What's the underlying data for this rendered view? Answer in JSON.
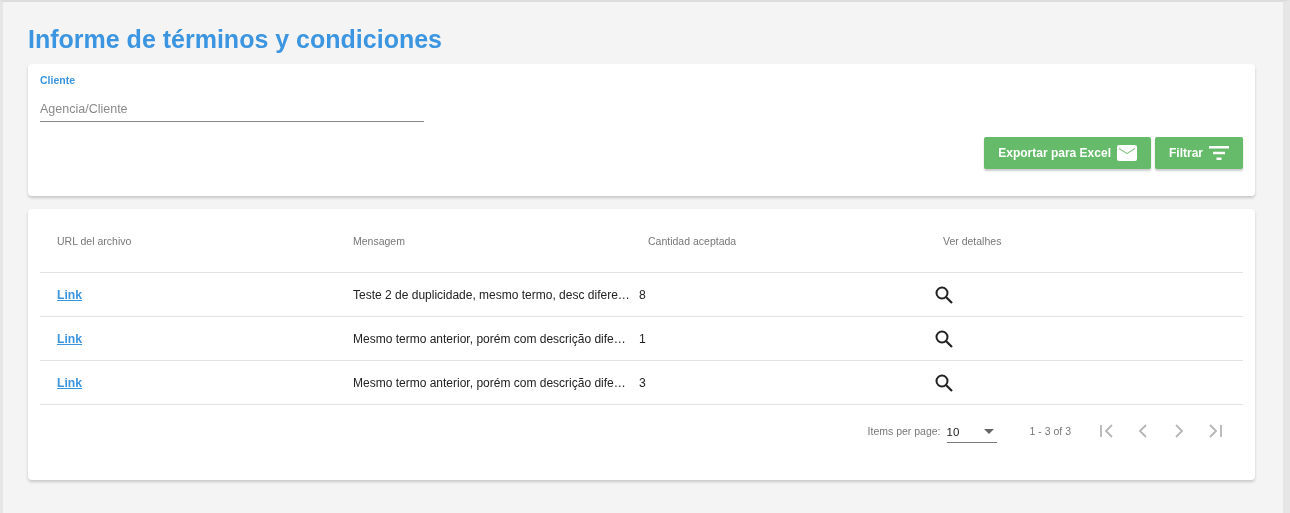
{
  "title": "Informe de términos y condiciones",
  "filter": {
    "label": "Cliente",
    "placeholder": "Agencia/Cliente",
    "buttons": [
      {
        "kind": "export",
        "label": "Exportar para Excel"
      },
      {
        "kind": "filter",
        "label": "Filtrar"
      }
    ]
  },
  "table": {
    "columns": [
      "URL del archivo",
      "Mensagem",
      "Cantidad aceptada",
      "Ver detalhes"
    ],
    "rows": [
      {
        "link": "Link",
        "message": "Teste 2 de duplicidade, mesmo termo, desc difere…",
        "count": "8"
      },
      {
        "link": "Link",
        "message": "Mesmo termo anterior, porém com descrição dife…",
        "count": "1"
      },
      {
        "link": "Link",
        "message": "Mesmo termo anterior, porém com descrição dife…",
        "count": "3"
      }
    ]
  },
  "paginator": {
    "label": "Items per page:",
    "page_size": "10",
    "range": "1 - 3 of 3",
    "buttons": [
      {
        "kind": "first",
        "disabled": true
      },
      {
        "kind": "prev",
        "disabled": true
      },
      {
        "kind": "next",
        "disabled": true
      },
      {
        "kind": "last",
        "disabled": true
      }
    ]
  }
}
